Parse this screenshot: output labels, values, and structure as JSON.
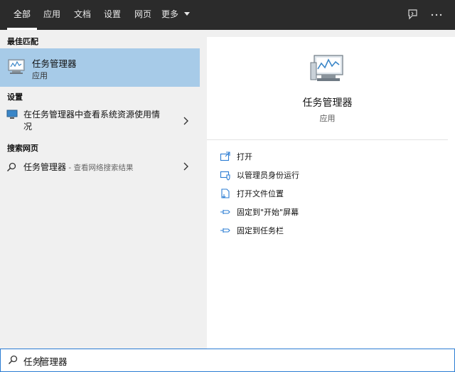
{
  "tabs": [
    {
      "label": "全部",
      "active": true
    },
    {
      "label": "应用"
    },
    {
      "label": "文档"
    },
    {
      "label": "设置"
    },
    {
      "label": "网页"
    },
    {
      "label": "更多"
    }
  ],
  "left": {
    "best_match_title": "最佳匹配",
    "best_match": {
      "name": "任务管理器",
      "type": "应用"
    },
    "settings_title": "设置",
    "settings_item": {
      "line1": "在任务管理器中查看系统资源使用情",
      "line2": "况"
    },
    "web_title": "搜索网页",
    "web_item": {
      "query": "任务管理器",
      "hint": " - 查看网络搜索结果"
    }
  },
  "right": {
    "app_name": "任务管理器",
    "app_type": "应用",
    "actions": [
      {
        "label": "打开",
        "icon": "open-icon"
      },
      {
        "label": "以管理员身份运行",
        "icon": "shield-icon"
      },
      {
        "label": "打开文件位置",
        "icon": "file-location-icon"
      },
      {
        "label": "固定到\"开始\"屏幕",
        "icon": "pin-icon"
      },
      {
        "label": "固定到任务栏",
        "icon": "pin-icon"
      }
    ]
  },
  "search": {
    "before_caret": "任务",
    "after_caret": "管理器"
  },
  "colors": {
    "topbar": "#2b2b2b",
    "selected": "#a7cbe8",
    "accent": "#2b7cd3"
  }
}
